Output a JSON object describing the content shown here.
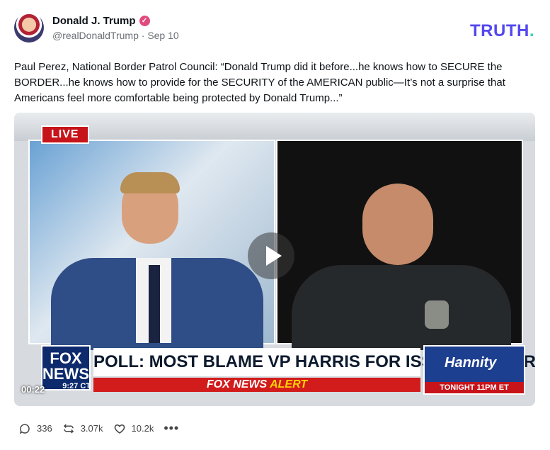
{
  "author": {
    "display_name": "Donald J. Trump",
    "handle": "@realDonaldTrump",
    "date": "Sep 10",
    "verified_icon": "verified-check-icon"
  },
  "brand": {
    "logo": "TRUTH",
    "dot": "."
  },
  "post": {
    "text": "Paul Perez, National Border Patrol Council: “Donald Trump did it before...he knows how to SECURE the BORDER...he knows how to provide for the SECURITY of the AMERICAN public—It’s not a surprise that Americans feel more comfortable being protected by Donald Trump...”"
  },
  "video": {
    "live_label": "LIVE",
    "fox_logo_line1": "FOX",
    "fox_logo_line2": "NEWS",
    "fox_time": "9:27 CT",
    "headline": "POLL: MOST BLAME VP HARRIS FOR ISSUES AT BORDER",
    "alert_prefix": "FOX NEWS ",
    "alert_word": "ALERT",
    "show_name": "Hannity",
    "show_time": "TONIGHT 11PM ET",
    "current_time": "00:22",
    "play_icon": "play-icon"
  },
  "actions": {
    "replies": "336",
    "retruths": "3.07k",
    "likes": "10.2k",
    "more": "•••"
  },
  "colors": {
    "brand_purple": "#5448ee",
    "brand_teal": "#34d3c0",
    "verified_pink": "#e14a7d"
  }
}
